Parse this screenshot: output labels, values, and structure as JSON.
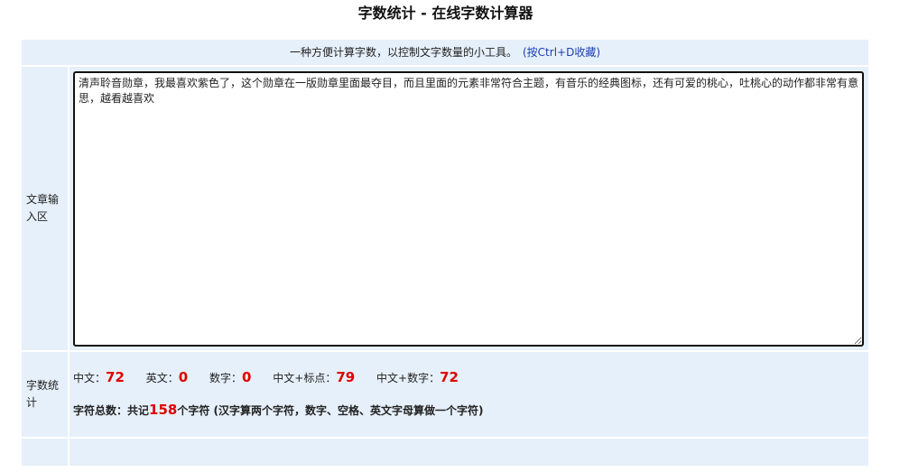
{
  "page": {
    "title": "字数统计 - 在线字数计算器"
  },
  "intro": {
    "text": "一种方便计算字数，以控制文字数量的小工具。",
    "shortcut": "(按Ctrl+D收藏)"
  },
  "input_section": {
    "label": "文章输入区",
    "value": "清声聆音勋章，我最喜欢紫色了，这个勋章在一版勋章里面最夺目，而且里面的元素非常符合主题，有音乐的经典图标，还有可爱的桃心，吐桃心的动作都非常有意思，越看越喜欢"
  },
  "stats_section": {
    "label": "字数统计",
    "chinese": {
      "label": "中文：",
      "value": "72"
    },
    "english": {
      "label": "英文：",
      "value": "0"
    },
    "digits": {
      "label": "数字：",
      "value": "0"
    },
    "chinese_punct": {
      "label": "中文+标点：",
      "value": "79"
    },
    "chinese_digits": {
      "label": "中文+数字：",
      "value": "72"
    },
    "total": {
      "prefix": "字符总数：共记",
      "value": "158",
      "suffix": "个字符 (汉字算两个字符，数字、空格、英文字母算做一个字符)"
    }
  },
  "colors": {
    "panel_bg": "#e6f0fa",
    "highlight_number": "#e00000",
    "link": "#1a3fb0"
  }
}
